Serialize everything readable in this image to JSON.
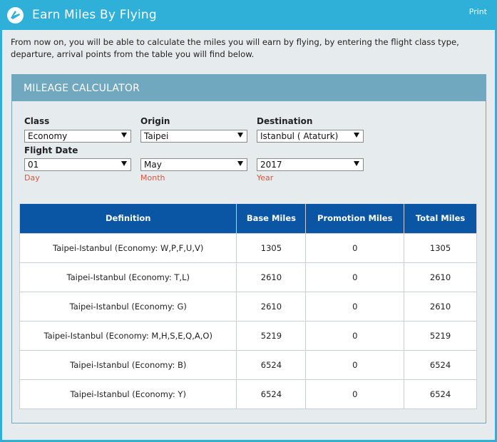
{
  "header": {
    "title": "Earn Miles By Flying",
    "print_label": "Print"
  },
  "intro": "From now on, you will be able to calculate the miles you will earn by flying, by entering the flight class type, departure, arrival points from the table you will find below.",
  "calculator": {
    "title": "MILEAGE CALCULATOR",
    "class": {
      "label": "Class",
      "value": "Economy"
    },
    "origin": {
      "label": "Origin",
      "value": "Taipei"
    },
    "destination": {
      "label": "Destination",
      "value": "Istanbul ( Ataturk)"
    },
    "flight_date": {
      "label": "Flight Date",
      "day": {
        "value": "01",
        "caption": "Day"
      },
      "month": {
        "value": "May",
        "caption": "Month"
      },
      "year": {
        "value": "2017",
        "caption": "Year"
      }
    }
  },
  "table": {
    "headers": [
      "Definition",
      "Base Miles",
      "Promotion Miles",
      "Total Miles"
    ],
    "rows": [
      [
        "Taipei-Istanbul (Economy: W,P,F,U,V)",
        "1305",
        "0",
        "1305"
      ],
      [
        "Taipei-Istanbul (Economy: T,L)",
        "2610",
        "0",
        "2610"
      ],
      [
        "Taipei-Istanbul (Economy: G)",
        "2610",
        "0",
        "2610"
      ],
      [
        "Taipei-Istanbul (Economy: M,H,S,E,Q,A,O)",
        "5219",
        "0",
        "5219"
      ],
      [
        "Taipei-Istanbul (Economy: B)",
        "6524",
        "0",
        "6524"
      ],
      [
        "Taipei-Istanbul (Economy: Y)",
        "6524",
        "0",
        "6524"
      ]
    ]
  },
  "colors": {
    "header_bg": "#2eb0d9",
    "calc_header_bg": "#6fa8bf",
    "table_header_bg": "#0b56a4",
    "caption_red": "#d9553f",
    "page_bg": "#e6ecee"
  },
  "icons": {
    "logo": "airline-logo-icon",
    "dropdown": "chevron-down-icon"
  }
}
